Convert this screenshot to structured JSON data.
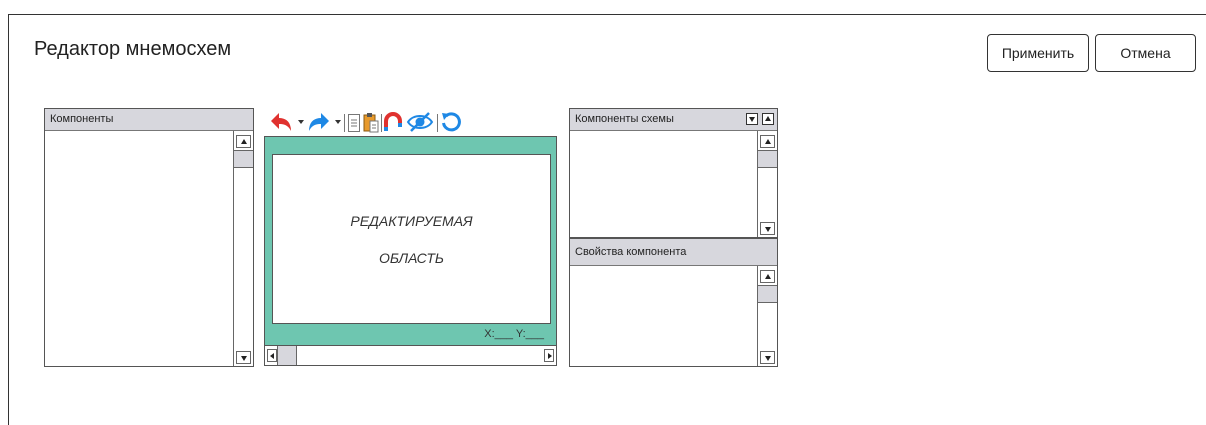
{
  "app": {
    "title": "Редактор мнемосхем"
  },
  "actions": {
    "apply_label": "Применить",
    "cancel_label": "Отмена"
  },
  "components_panel": {
    "title": "Компоненты"
  },
  "toolbar": {
    "icons": [
      "undo-icon",
      "undo-dropdown-icon",
      "redo-icon",
      "redo-dropdown-icon",
      "copy-icon",
      "paste-icon",
      "magnet-icon",
      "hide-icon",
      "refresh-icon"
    ]
  },
  "editor": {
    "area_text_line1": "РЕДАКТИРУЕМАЯ",
    "area_text_line2": "ОБЛАСТЬ",
    "coords_text": "X:___ Y:___",
    "background_color": "#6ec6b0"
  },
  "schema_components_panel": {
    "title": "Компоненты схемы"
  },
  "properties_panel": {
    "title": "Свойства компонента"
  },
  "colors": {
    "header_bg": "#d7d7dd",
    "accent_red": "#e0322f",
    "accent_blue": "#1e88e5"
  }
}
